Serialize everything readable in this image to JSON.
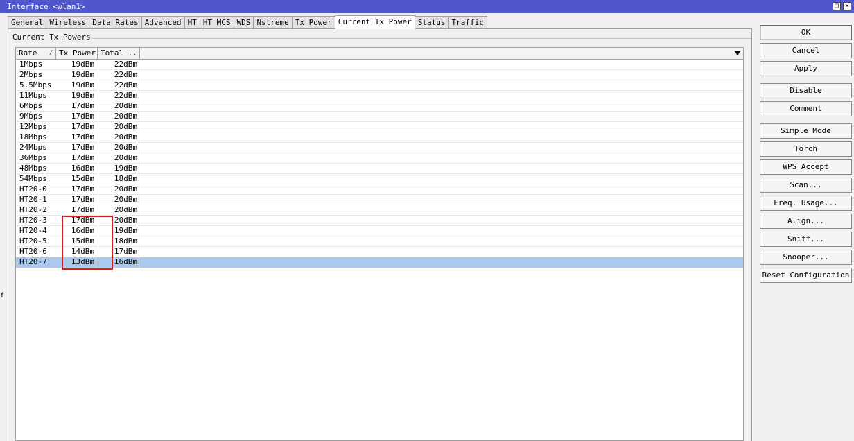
{
  "window": {
    "title": "Interface <wlan1>",
    "restore_glyph": "❐",
    "close_glyph": "✕"
  },
  "left_edge_char": "f",
  "tabs": [
    {
      "label": "General",
      "active": false
    },
    {
      "label": "Wireless",
      "active": false
    },
    {
      "label": "Data Rates",
      "active": false
    },
    {
      "label": "Advanced",
      "active": false
    },
    {
      "label": "HT",
      "active": false
    },
    {
      "label": "HT MCS",
      "active": false
    },
    {
      "label": "WDS",
      "active": false
    },
    {
      "label": "Nstreme",
      "active": false
    },
    {
      "label": "Tx Power",
      "active": false
    },
    {
      "label": "Current Tx Power",
      "active": true
    },
    {
      "label": "Status",
      "active": false
    },
    {
      "label": "Traffic",
      "active": false
    }
  ],
  "group": {
    "label": "Current Tx Powers"
  },
  "table": {
    "columns": [
      {
        "label": "Rate",
        "sort_glyph": "/"
      },
      {
        "label": "Tx Power"
      },
      {
        "label": "Total ..."
      }
    ],
    "rows": [
      {
        "rate": "1Mbps",
        "tx_power": "19dBm",
        "total": "22dBm"
      },
      {
        "rate": "2Mbps",
        "tx_power": "19dBm",
        "total": "22dBm"
      },
      {
        "rate": "5.5Mbps",
        "tx_power": "19dBm",
        "total": "22dBm"
      },
      {
        "rate": "11Mbps",
        "tx_power": "19dBm",
        "total": "22dBm"
      },
      {
        "rate": "6Mbps",
        "tx_power": "17dBm",
        "total": "20dBm"
      },
      {
        "rate": "9Mbps",
        "tx_power": "17dBm",
        "total": "20dBm"
      },
      {
        "rate": "12Mbps",
        "tx_power": "17dBm",
        "total": "20dBm"
      },
      {
        "rate": "18Mbps",
        "tx_power": "17dBm",
        "total": "20dBm"
      },
      {
        "rate": "24Mbps",
        "tx_power": "17dBm",
        "total": "20dBm"
      },
      {
        "rate": "36Mbps",
        "tx_power": "17dBm",
        "total": "20dBm"
      },
      {
        "rate": "48Mbps",
        "tx_power": "16dBm",
        "total": "19dBm"
      },
      {
        "rate": "54Mbps",
        "tx_power": "15dBm",
        "total": "18dBm"
      },
      {
        "rate": "HT20-0",
        "tx_power": "17dBm",
        "total": "20dBm"
      },
      {
        "rate": "HT20-1",
        "tx_power": "17dBm",
        "total": "20dBm"
      },
      {
        "rate": "HT20-2",
        "tx_power": "17dBm",
        "total": "20dBm"
      },
      {
        "rate": "HT20-3",
        "tx_power": "17dBm",
        "total": "20dBm"
      },
      {
        "rate": "HT20-4",
        "tx_power": "16dBm",
        "total": "19dBm"
      },
      {
        "rate": "HT20-5",
        "tx_power": "15dBm",
        "total": "18dBm"
      },
      {
        "rate": "HT20-6",
        "tx_power": "14dBm",
        "total": "17dBm"
      },
      {
        "rate": "HT20-7",
        "tx_power": "13dBm",
        "total": "16dBm",
        "selected": true
      }
    ]
  },
  "buttons": [
    {
      "label": "OK",
      "name": "ok-button"
    },
    {
      "label": "Cancel",
      "name": "cancel-button"
    },
    {
      "label": "Apply",
      "name": "apply-button"
    },
    {
      "label": "Disable",
      "name": "disable-button"
    },
    {
      "label": "Comment",
      "name": "comment-button"
    },
    {
      "label": "Simple Mode",
      "name": "simple-mode-button"
    },
    {
      "label": "Torch",
      "name": "torch-button"
    },
    {
      "label": "WPS Accept",
      "name": "wps-accept-button"
    },
    {
      "label": "Scan...",
      "name": "scan-button"
    },
    {
      "label": "Freq. Usage...",
      "name": "freq-usage-button"
    },
    {
      "label": "Align...",
      "name": "align-button"
    },
    {
      "label": "Sniff...",
      "name": "sniff-button"
    },
    {
      "label": "Snooper...",
      "name": "snooper-button"
    },
    {
      "label": "Reset Configuration",
      "name": "reset-configuration-button"
    }
  ],
  "colors": {
    "titlebar": "#5057cc",
    "selected_row": "#a9c9ee",
    "annotation_box": "#e01b1b"
  }
}
